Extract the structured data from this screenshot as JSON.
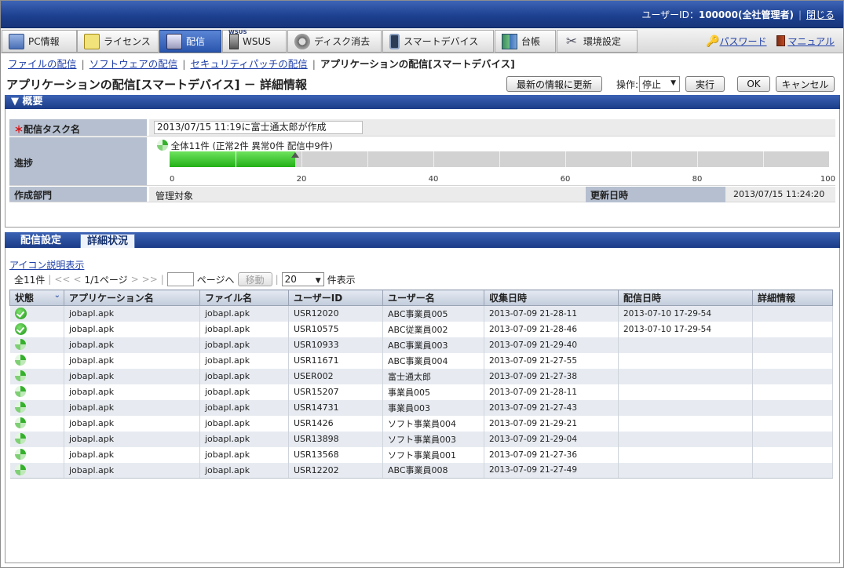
{
  "header": {
    "user_label": "ユーザーID：",
    "user_value": "100000(全社管理者)",
    "close_label": "閉じる"
  },
  "tabs": [
    {
      "label": "PC情報",
      "icon": "pc-icon"
    },
    {
      "label": "ライセンス",
      "icon": "license-icon"
    },
    {
      "label": "配信",
      "icon": "distribution-icon",
      "active": true
    },
    {
      "label": "WSUS",
      "icon": "wsus-icon",
      "badge": "WSUS"
    },
    {
      "label": "ディスク消去",
      "icon": "disk-erase-icon"
    },
    {
      "label": "スマートデバイス",
      "icon": "smartphone-icon"
    },
    {
      "label": "台帳",
      "icon": "ledger-icon"
    },
    {
      "label": "環境設定",
      "icon": "tools-icon"
    }
  ],
  "toplinks": {
    "password": "パスワード",
    "manual": "マニュアル"
  },
  "breadcrumb": {
    "items": [
      "ファイルの配信",
      "ソフトウェアの配信",
      "セキュリティパッチの配信"
    ],
    "current": "アプリケーションの配信[スマートデバイス]"
  },
  "page": {
    "title": "アプリケーションの配信[スマートデバイス] － 詳細情報",
    "refresh_label": "最新の情報に更新",
    "operation_label": "操作:",
    "operation_value": "停止",
    "execute_label": "実行",
    "ok_label": "OK",
    "cancel_label": "キャンセル"
  },
  "overview": {
    "section_title": "概要",
    "task_name_label": "配信タスク名",
    "task_name_value": "2013/07/15 11:19に富士通太郎が作成",
    "progress_label": "進捗",
    "progress_text": "全体11件 (正常2件 異常0件 配信中9件)",
    "progress_percent": 19,
    "ticks": [
      "0",
      "20",
      "40",
      "60",
      "80",
      "100"
    ],
    "dept_label": "作成部門",
    "dept_value": "管理対象",
    "updated_label": "更新日時",
    "updated_value": "2013/07/15 11:24:20"
  },
  "subtabs": {
    "settings": "配信設定",
    "details": "詳細状況"
  },
  "details": {
    "icon_legend_link": "アイコン説明表示",
    "total": "全11件",
    "first": "<<",
    "prev": "<",
    "page_info": "1/1ページ",
    "next": ">",
    "last": ">>",
    "goto_label": "ページへ",
    "move_label": "移動",
    "per_page": "20",
    "per_page_suffix": "件表示"
  },
  "table": {
    "columns": [
      "状態",
      "アプリケーション名",
      "ファイル名",
      "ユーザーID",
      "ユーザー名",
      "収集日時",
      "配信日時",
      "詳細情報"
    ],
    "rows": [
      {
        "status": "complete",
        "app": "jobapl.apk",
        "file": "jobapl.apk",
        "uid": "USR12020",
        "uname": "ABC事業員005",
        "collected": "2013-07-09 21-28-11",
        "delivered": "2013-07-10 17-29-54",
        "detail": ""
      },
      {
        "status": "complete",
        "app": "jobapl.apk",
        "file": "jobapl.apk",
        "uid": "USR10575",
        "uname": "ABC従業員002",
        "collected": "2013-07-09 21-28-46",
        "delivered": "2013-07-10 17-29-54",
        "detail": ""
      },
      {
        "status": "in-progress",
        "app": "jobapl.apk",
        "file": "jobapl.apk",
        "uid": "USR10933",
        "uname": "ABC事業員003",
        "collected": "2013-07-09 21-29-40",
        "delivered": "",
        "detail": ""
      },
      {
        "status": "in-progress",
        "app": "jobapl.apk",
        "file": "jobapl.apk",
        "uid": "USR11671",
        "uname": "ABC事業員004",
        "collected": "2013-07-09 21-27-55",
        "delivered": "",
        "detail": ""
      },
      {
        "status": "in-progress",
        "app": "jobapl.apk",
        "file": "jobapl.apk",
        "uid": "USER002",
        "uname": "富士通太郎",
        "collected": "2013-07-09 21-27-38",
        "delivered": "",
        "detail": ""
      },
      {
        "status": "in-progress",
        "app": "jobapl.apk",
        "file": "jobapl.apk",
        "uid": "USR15207",
        "uname": "事業員005",
        "collected": "2013-07-09 21-28-11",
        "delivered": "",
        "detail": ""
      },
      {
        "status": "in-progress",
        "app": "jobapl.apk",
        "file": "jobapl.apk",
        "uid": "USR14731",
        "uname": "事業員003",
        "collected": "2013-07-09 21-27-43",
        "delivered": "",
        "detail": ""
      },
      {
        "status": "in-progress",
        "app": "jobapl.apk",
        "file": "jobapl.apk",
        "uid": "USR1426",
        "uname": "ソフト事業員004",
        "collected": "2013-07-09 21-29-21",
        "delivered": "",
        "detail": ""
      },
      {
        "status": "in-progress",
        "app": "jobapl.apk",
        "file": "jobapl.apk",
        "uid": "USR13898",
        "uname": "ソフト事業員003",
        "collected": "2013-07-09 21-29-04",
        "delivered": "",
        "detail": ""
      },
      {
        "status": "in-progress",
        "app": "jobapl.apk",
        "file": "jobapl.apk",
        "uid": "USR13568",
        "uname": "ソフト事業員001",
        "collected": "2013-07-09 21-27-36",
        "delivered": "",
        "detail": ""
      },
      {
        "status": "in-progress",
        "app": "jobapl.apk",
        "file": "jobapl.apk",
        "uid": "USR12202",
        "uname": "ABC事業員008",
        "collected": "2013-07-09 21-27-49",
        "delivered": "",
        "detail": ""
      }
    ]
  },
  "colors": {
    "header_blue": "#1c3f8e",
    "progress_green": "#22b016",
    "link": "#1f3fa8"
  }
}
